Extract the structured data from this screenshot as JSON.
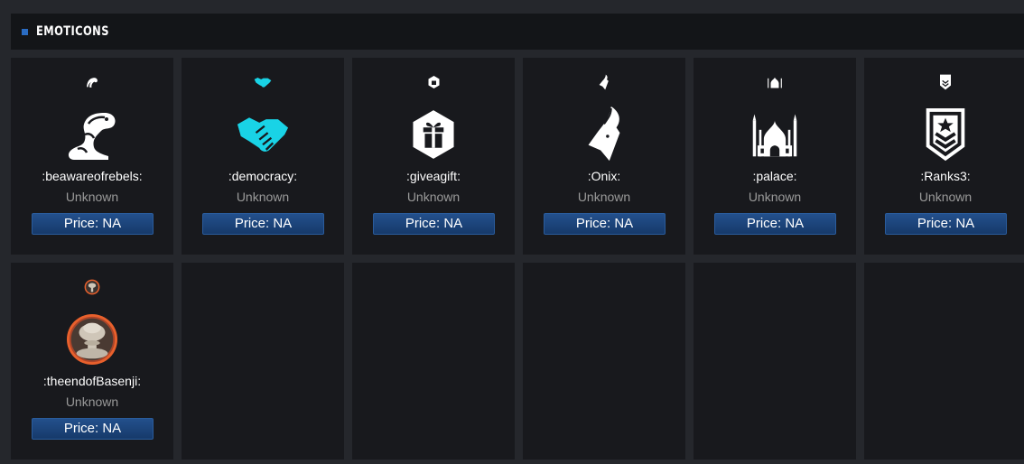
{
  "section": {
    "title": "EMOTICONS"
  },
  "items": [
    {
      "name": ":beawareofrebels:",
      "rarity": "Unknown",
      "price": "Price: NA",
      "icon": "snake-icon",
      "color": "#ffffff"
    },
    {
      "name": ":democracy:",
      "rarity": "Unknown",
      "price": "Price: NA",
      "icon": "handshake-icon",
      "color": "#19d3e6"
    },
    {
      "name": ":giveagift:",
      "rarity": "Unknown",
      "price": "Price: NA",
      "icon": "gift-icon",
      "color": "#ffffff"
    },
    {
      "name": ":Onix:",
      "rarity": "Unknown",
      "price": "Price: NA",
      "icon": "goat-icon",
      "color": "#ffffff"
    },
    {
      "name": ":palace:",
      "rarity": "Unknown",
      "price": "Price: NA",
      "icon": "mosque-icon",
      "color": "#ffffff"
    },
    {
      "name": ":Ranks3:",
      "rarity": "Unknown",
      "price": "Price: NA",
      "icon": "rank-badge-icon",
      "color": "#ffffff"
    },
    {
      "name": ":theendofBasenji:",
      "rarity": "Unknown",
      "price": "Price: NA",
      "icon": "mushroom-cloud-icon",
      "color": "#e8602c"
    }
  ]
}
